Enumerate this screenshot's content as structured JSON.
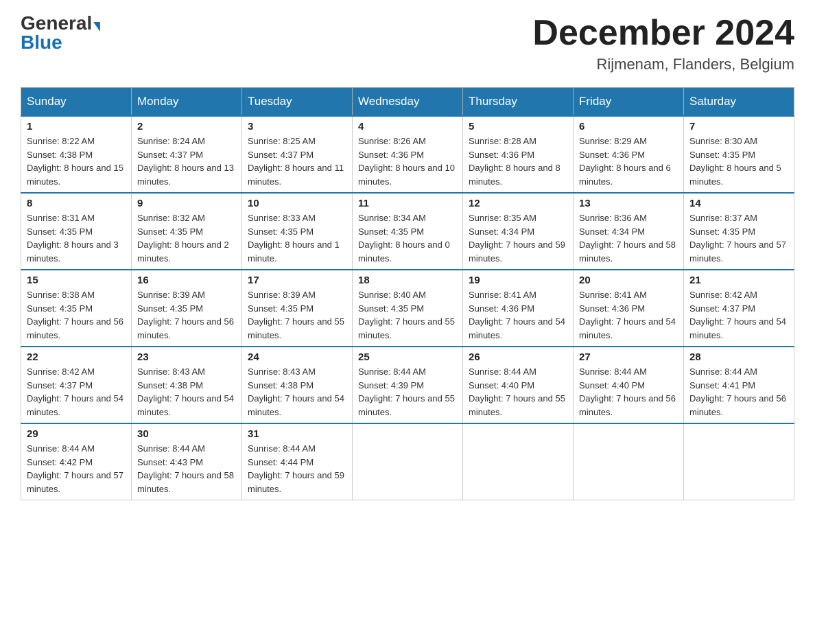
{
  "header": {
    "logo_general": "General",
    "logo_blue": "Blue",
    "month_title": "December 2024",
    "location": "Rijmenam, Flanders, Belgium"
  },
  "weekdays": [
    "Sunday",
    "Monday",
    "Tuesday",
    "Wednesday",
    "Thursday",
    "Friday",
    "Saturday"
  ],
  "weeks": [
    [
      {
        "day": "1",
        "sunrise": "8:22 AM",
        "sunset": "4:38 PM",
        "daylight": "8 hours and 15 minutes."
      },
      {
        "day": "2",
        "sunrise": "8:24 AM",
        "sunset": "4:37 PM",
        "daylight": "8 hours and 13 minutes."
      },
      {
        "day": "3",
        "sunrise": "8:25 AM",
        "sunset": "4:37 PM",
        "daylight": "8 hours and 11 minutes."
      },
      {
        "day": "4",
        "sunrise": "8:26 AM",
        "sunset": "4:36 PM",
        "daylight": "8 hours and 10 minutes."
      },
      {
        "day": "5",
        "sunrise": "8:28 AM",
        "sunset": "4:36 PM",
        "daylight": "8 hours and 8 minutes."
      },
      {
        "day": "6",
        "sunrise": "8:29 AM",
        "sunset": "4:36 PM",
        "daylight": "8 hours and 6 minutes."
      },
      {
        "day": "7",
        "sunrise": "8:30 AM",
        "sunset": "4:35 PM",
        "daylight": "8 hours and 5 minutes."
      }
    ],
    [
      {
        "day": "8",
        "sunrise": "8:31 AM",
        "sunset": "4:35 PM",
        "daylight": "8 hours and 3 minutes."
      },
      {
        "day": "9",
        "sunrise": "8:32 AM",
        "sunset": "4:35 PM",
        "daylight": "8 hours and 2 minutes."
      },
      {
        "day": "10",
        "sunrise": "8:33 AM",
        "sunset": "4:35 PM",
        "daylight": "8 hours and 1 minute."
      },
      {
        "day": "11",
        "sunrise": "8:34 AM",
        "sunset": "4:35 PM",
        "daylight": "8 hours and 0 minutes."
      },
      {
        "day": "12",
        "sunrise": "8:35 AM",
        "sunset": "4:34 PM",
        "daylight": "7 hours and 59 minutes."
      },
      {
        "day": "13",
        "sunrise": "8:36 AM",
        "sunset": "4:34 PM",
        "daylight": "7 hours and 58 minutes."
      },
      {
        "day": "14",
        "sunrise": "8:37 AM",
        "sunset": "4:35 PM",
        "daylight": "7 hours and 57 minutes."
      }
    ],
    [
      {
        "day": "15",
        "sunrise": "8:38 AM",
        "sunset": "4:35 PM",
        "daylight": "7 hours and 56 minutes."
      },
      {
        "day": "16",
        "sunrise": "8:39 AM",
        "sunset": "4:35 PM",
        "daylight": "7 hours and 56 minutes."
      },
      {
        "day": "17",
        "sunrise": "8:39 AM",
        "sunset": "4:35 PM",
        "daylight": "7 hours and 55 minutes."
      },
      {
        "day": "18",
        "sunrise": "8:40 AM",
        "sunset": "4:35 PM",
        "daylight": "7 hours and 55 minutes."
      },
      {
        "day": "19",
        "sunrise": "8:41 AM",
        "sunset": "4:36 PM",
        "daylight": "7 hours and 54 minutes."
      },
      {
        "day": "20",
        "sunrise": "8:41 AM",
        "sunset": "4:36 PM",
        "daylight": "7 hours and 54 minutes."
      },
      {
        "day": "21",
        "sunrise": "8:42 AM",
        "sunset": "4:37 PM",
        "daylight": "7 hours and 54 minutes."
      }
    ],
    [
      {
        "day": "22",
        "sunrise": "8:42 AM",
        "sunset": "4:37 PM",
        "daylight": "7 hours and 54 minutes."
      },
      {
        "day": "23",
        "sunrise": "8:43 AM",
        "sunset": "4:38 PM",
        "daylight": "7 hours and 54 minutes."
      },
      {
        "day": "24",
        "sunrise": "8:43 AM",
        "sunset": "4:38 PM",
        "daylight": "7 hours and 54 minutes."
      },
      {
        "day": "25",
        "sunrise": "8:44 AM",
        "sunset": "4:39 PM",
        "daylight": "7 hours and 55 minutes."
      },
      {
        "day": "26",
        "sunrise": "8:44 AM",
        "sunset": "4:40 PM",
        "daylight": "7 hours and 55 minutes."
      },
      {
        "day": "27",
        "sunrise": "8:44 AM",
        "sunset": "4:40 PM",
        "daylight": "7 hours and 56 minutes."
      },
      {
        "day": "28",
        "sunrise": "8:44 AM",
        "sunset": "4:41 PM",
        "daylight": "7 hours and 56 minutes."
      }
    ],
    [
      {
        "day": "29",
        "sunrise": "8:44 AM",
        "sunset": "4:42 PM",
        "daylight": "7 hours and 57 minutes."
      },
      {
        "day": "30",
        "sunrise": "8:44 AM",
        "sunset": "4:43 PM",
        "daylight": "7 hours and 58 minutes."
      },
      {
        "day": "31",
        "sunrise": "8:44 AM",
        "sunset": "4:44 PM",
        "daylight": "7 hours and 59 minutes."
      },
      null,
      null,
      null,
      null
    ]
  ],
  "labels": {
    "sunrise": "Sunrise:",
    "sunset": "Sunset:",
    "daylight": "Daylight:"
  }
}
